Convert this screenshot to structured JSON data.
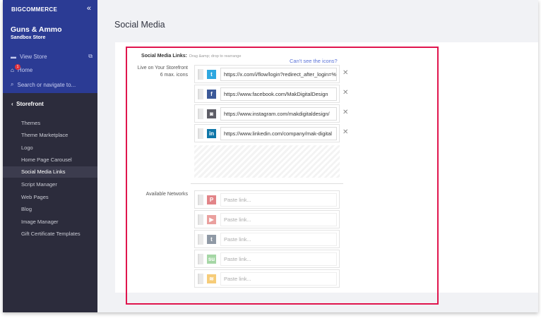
{
  "sidebar": {
    "logo": "BIGCOMMERCE",
    "store_name": "Guns & Ammo",
    "store_sub": "Sandbox Store",
    "view_store": "View Store",
    "home": "Home",
    "home_badge": "1",
    "search": "Search or navigate to...",
    "section": "Storefront",
    "items": [
      "Themes",
      "Theme Marketplace",
      "Logo",
      "Home Page Carousel",
      "Social Media Links",
      "Script Manager",
      "Web Pages",
      "Blog",
      "Image Manager",
      "Gift Certificate Templates"
    ]
  },
  "page": {
    "title": "Social Media",
    "links_label": "Social Media Links:",
    "links_hint": "Drag &amp; drop to rearrange",
    "cant_see": "Can't see the icons?",
    "live_label": "Live on Your Storefront",
    "max_icons": "6 max. icons",
    "available_label": "Available Networks",
    "live": [
      {
        "network": "twitter",
        "icon": "t",
        "color": "#2da7e0",
        "url": "https://x.com/i/flow/login?redirect_after_login=%"
      },
      {
        "network": "facebook",
        "icon": "f",
        "color": "#3b5998",
        "url": "https://www.facebook.com/MakDigitalDesign"
      },
      {
        "network": "instagram",
        "icon": "◙",
        "color": "#5d5d66",
        "url": "https://www.instagram.com/makdigitaldesign/"
      },
      {
        "network": "linkedin",
        "icon": "in",
        "color": "#0e76a8",
        "url": "https://www.linkedin.com/company/mak-digital"
      }
    ],
    "available": [
      {
        "network": "pinterest",
        "icon": "P",
        "color": "#cb2027",
        "placeholder": "Paste link..."
      },
      {
        "network": "youtube",
        "icon": "▶",
        "color": "#d9534f",
        "placeholder": "Paste link..."
      },
      {
        "network": "tumblr",
        "icon": "t",
        "color": "#35465c",
        "placeholder": "Paste link..."
      },
      {
        "network": "stumbleupon",
        "icon": "su",
        "color": "#5cb85c",
        "placeholder": "Paste link..."
      },
      {
        "network": "rss",
        "icon": "≋",
        "color": "#f0a30a",
        "placeholder": "Paste link..."
      }
    ]
  }
}
